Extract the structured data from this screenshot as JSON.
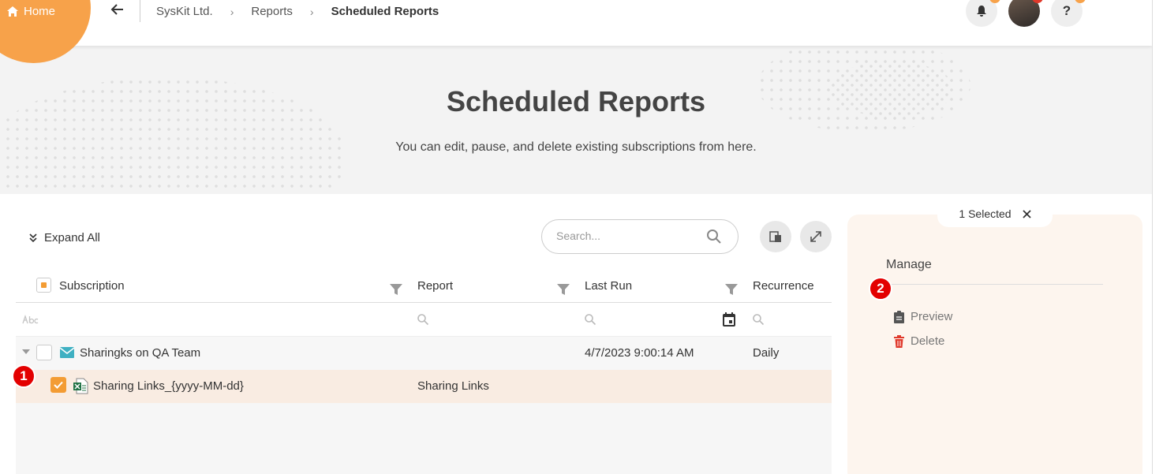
{
  "header": {
    "home_label": "Home",
    "breadcrumbs": [
      "SysKit Ltd.",
      "Reports",
      "Scheduled Reports"
    ],
    "icons": [
      "bell-icon",
      "user-avatar",
      "help-icon"
    ]
  },
  "hero": {
    "title": "Scheduled Reports",
    "subtitle": "You can edit, pause, and delete existing subscriptions from here."
  },
  "toolbar": {
    "expand_all_label": "Expand All",
    "search_placeholder": "Search..."
  },
  "grid": {
    "columns": [
      "Subscription",
      "Report",
      "Last Run",
      "Recurrence"
    ],
    "rows": [
      {
        "subscription": "Sharingks on QA Team",
        "report": "",
        "last_run": "4/7/2023 9:00:14 AM",
        "recurrence": "Daily"
      },
      {
        "subscription": "Sharing Links_{yyyy-MM-dd}",
        "report": "Sharing Links",
        "last_run": "",
        "recurrence": ""
      }
    ]
  },
  "panel": {
    "selected_label": "1 Selected",
    "section_title": "Manage",
    "actions": [
      "Preview",
      "Delete"
    ]
  },
  "callouts": [
    "1",
    "2"
  ],
  "colors": {
    "accent": "#f39c34",
    "callout": "#e30000",
    "selected_row": "#f9ece2",
    "panel_bg": "#fdf5ee"
  }
}
